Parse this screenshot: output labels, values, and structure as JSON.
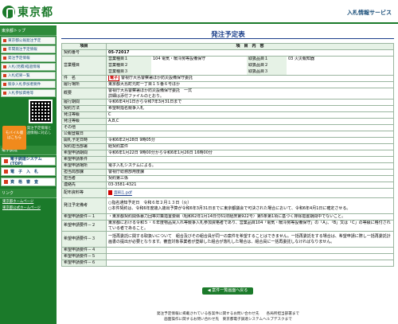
{
  "header": {
    "logo_text": "東京都",
    "service_name": "入札情報サービス"
  },
  "sidebar": {
    "heading_top": "東京都トップ",
    "items": [
      "東京都公報発注予定",
      "年間発注予定情報",
      "発注予定情報",
      "入札(見積)経過情報",
      "入札結果一覧",
      "競争入札参加者要件",
      "入札参加資格等"
    ],
    "mobile_label": "モバイル版",
    "mobile_sub": "はこちら",
    "mobile_note": "モバイル版は、発注予定情報と入札（見積）経過情報に対応しています。",
    "heading_links": "電子調達",
    "big_items": [
      "電子調達システム(TOP)",
      "電　子　入　札",
      "資　格　審　査"
    ],
    "heading_more": "リンク",
    "links": [
      "東京都ホームページ",
      "東京都公式ホームページ"
    ]
  },
  "main": {
    "title": "発注予定表",
    "header_item": "項目",
    "header_content": "項　目　内　容",
    "rows": {
      "contract_no_label": "契約番号",
      "contract_no": "05-72017",
      "category_label": "営業種目",
      "cat1_label": "営業種目１",
      "cat1_value": "104 電気・暖冷房等設備保守",
      "cat2_label": "営業種目２",
      "cat3_label": "営業種目３",
      "grade1_label": "取扱品目１",
      "grade1_value": "03 火災報知器",
      "grade2_label": "取扱品目２",
      "grade3_label": "取扱品目３",
      "name_label": "件　名",
      "name_tag": "電子",
      "name_value": "警視庁大島警察署ほか防災設備保守委託",
      "place_label": "履行場所",
      "place_value": "東京都大島町元町一丁目１５番６号ほか",
      "summary_label": "概要",
      "summary_value": "警視庁大島警察署ほか防災設備保守委託　一式",
      "summary_value2": "詳細は添付ファイルのとおり。",
      "period_label": "履行期間",
      "period_value": "令和6年4月1日から令和7年3月31日まで",
      "method_label": "契約方法",
      "method_value": "希望制指名競争入札",
      "class_label": "発注等級",
      "class_value": "C",
      "grade_label": "発注等級",
      "grade_value": "A,B,C",
      "other_label": "その他",
      "notice_label": "公報登載日",
      "open_label": "開札予定日時",
      "open_value": "令和6年2月28日 9時05分",
      "dept_label": "契約担当部署",
      "dept_value": "経契約案件",
      "hope_label": "希望申請期間",
      "hope_value": "令和6年1月22日 9時00分から令和6年1月26日 16時00分",
      "condition_label": "希望申請条件",
      "place2_label": "希望申請場所",
      "place2_value": "電子入札システムによる。",
      "office_label": "担当局部課",
      "office_value": "警視庁総務部用度課",
      "person_label": "担当者",
      "person_value": "契約第三係",
      "tel_label": "連絡先",
      "tel_value": "03-3581-4321",
      "attach_label": "配布資料等",
      "attach_value": "資料1.pdf",
      "remarks_label": "発注予定備考",
      "remarks_a": "○指名通知予定日　令和６年２月１３日（火）",
      "remarks_b": "○本件契約は、令和6年度歳入歳出予算が令和6年3月31日までに東京都議会で可決された場合において、令和6年4月1日に確定させる。",
      "hope1_label": "希望申請要件－１",
      "hope1_value": "・東京都契約関係暴力団等対策措置要綱（昭和62年1月14日付61財経庶第922号）第5条第1項に基づく排除措置期間中でないこと。",
      "hope2_label": "希望申請要件－２",
      "hope2_value": "東京都における令和５・６年度物品買入れ等競争入札参加資格者であり、営業品目104「電気・暖冷房等設備保守」の「A」、「B」又は「C」の等級に格付されている者であること。",
      "hope3_label": "希望申請要件－３",
      "hope3_value": "一括再委託に関する取扱いについて　組合及びその組合員が同一の案件を希望することはできません。一括再委託をする場合は、希望申請に際し一括再委託計画書の提出が必要となります。審査対象事業者が登録した組合が落札した場合は、組合員に一括再委託しなければなりません。",
      "hope4_label": "希望申請要件－４",
      "hope5_label": "希望申請要件－５",
      "hope6_label": "希望申請要件－６"
    },
    "back_button": "◀ 案件一覧画面へ戻る",
    "footer_line1": "発注予定情報に掲載されている各案件に関するお問い合わせ先　　各局所担当部署まで",
    "footer_line2": "画面操作に関するお問い合わせ先　東京都電子調達システムヘルプデスクまで"
  }
}
